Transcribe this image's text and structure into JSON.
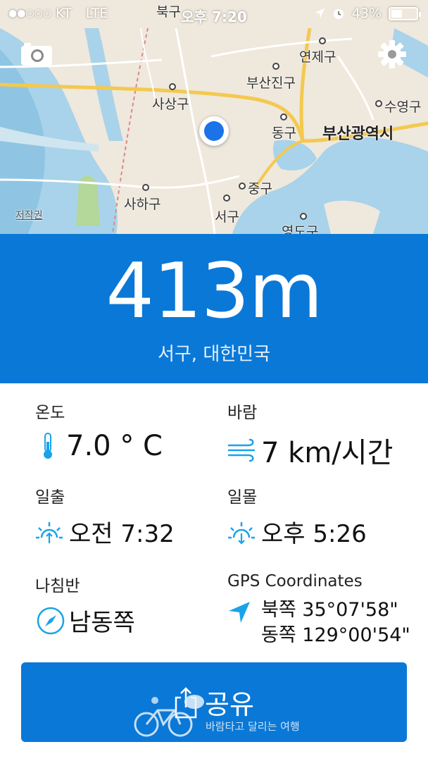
{
  "status_bar": {
    "carrier": "KT",
    "network": "LTE",
    "time": "오후 7:20",
    "battery": "43%",
    "battery_level": 0.43
  },
  "map": {
    "labels": {
      "bukgu": "북구",
      "yeonjegu": "연제구",
      "busanjingu": "부산진구",
      "sasanggu": "사상구",
      "suyeonggu": "수영구",
      "donggu": "동구",
      "busan": "부산광역시",
      "junggu": "중구",
      "sahagu": "사하구",
      "seogu": "서구",
      "yeongdogu": "영도구",
      "copyright": "저작권"
    }
  },
  "altitude": {
    "value": "413m",
    "place": "서구, 대한민국"
  },
  "info": {
    "temperature": {
      "label": "온도",
      "value": "7.0 ° C"
    },
    "wind": {
      "label": "바람",
      "value": "7 km/시간"
    },
    "sunrise": {
      "label": "일출",
      "value": "오전 7:32"
    },
    "sunset": {
      "label": "일몰",
      "value": "오후 5:26"
    },
    "compass": {
      "label": "나침반",
      "value": "남동쪽"
    },
    "gps": {
      "label": "GPS Coordinates",
      "lat": "북쪽 35°07'58\"",
      "lon": "동쪽 129°00'54\""
    }
  },
  "share": {
    "label": "공유",
    "watermark": "바람타고 달리는 여행"
  },
  "colors": {
    "accent": "#0a78d7",
    "icon": "#1aa3e8",
    "map_water": "#a8d3ea",
    "map_land": "#efe8dc",
    "road": "#f3c94f"
  }
}
